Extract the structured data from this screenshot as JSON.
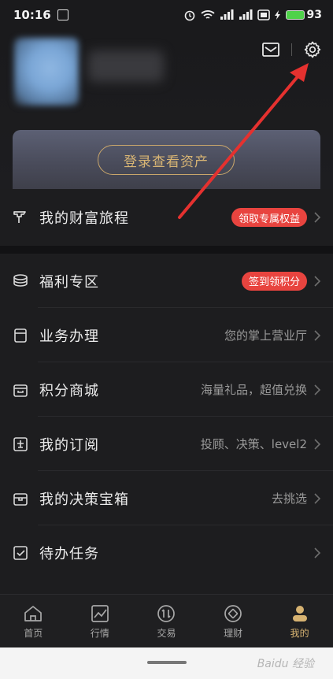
{
  "status_bar": {
    "time": "10:16",
    "battery": "93"
  },
  "header": {
    "login_button": "登录查看资产"
  },
  "journey": {
    "label": "我的财富旅程",
    "badge": "领取专属权益"
  },
  "menu": [
    {
      "label": "福利专区",
      "badge": "签到领积分",
      "desc": null,
      "icon": "coins-icon"
    },
    {
      "label": "业务办理",
      "badge": null,
      "desc": "您的掌上营业厅",
      "icon": "document-icon"
    },
    {
      "label": "积分商城",
      "badge": null,
      "desc": "海量礼品，超值兑换",
      "icon": "store-icon"
    },
    {
      "label": "我的订阅",
      "badge": null,
      "desc": "投顾、决策、level2",
      "icon": "subscription-icon"
    },
    {
      "label": "我的决策宝箱",
      "badge": null,
      "desc": "去挑选",
      "icon": "treasure-box-icon"
    },
    {
      "label": "待办任务",
      "badge": null,
      "desc": "",
      "icon": "checklist-icon"
    }
  ],
  "tabs": [
    {
      "label": "首页",
      "icon": "home-icon",
      "active": false
    },
    {
      "label": "行情",
      "icon": "market-chart-icon",
      "active": false
    },
    {
      "label": "交易",
      "icon": "trade-icon",
      "active": false
    },
    {
      "label": "理财",
      "icon": "wealth-icon",
      "active": false
    },
    {
      "label": "我的",
      "icon": "profile-icon",
      "active": true
    }
  ],
  "watermark": "Baidu 经验",
  "colors": {
    "accent_gold": "#d6b271",
    "badge_red": "#e8443f",
    "arrow_red": "#e5312f",
    "background": "#1d1d1f"
  }
}
